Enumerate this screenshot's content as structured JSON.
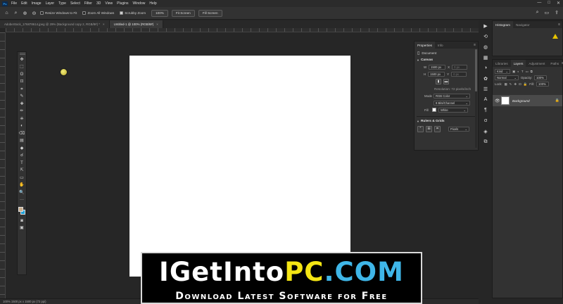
{
  "menubar": {
    "app_logo": "Ps",
    "items": [
      "File",
      "Edit",
      "Image",
      "Layer",
      "Type",
      "Select",
      "Filter",
      "3D",
      "View",
      "Plugins",
      "Window",
      "Help"
    ],
    "window_controls": [
      "—",
      "□",
      "✕"
    ]
  },
  "options": {
    "resize_windows": "Resize Windows to Fit",
    "zoom_all": "Zoom All Windows",
    "scrubby_zoom": "Scrubby Zoom",
    "zoom_value": "100%",
    "fit_screen": "Fit Screen",
    "fill_screen": "Fill Screen"
  },
  "tabs": [
    {
      "label": "AdobeStock_176878614.jpeg @ 29% (Background copy 2, RGB/8#) *",
      "active": false
    },
    {
      "label": "Untitled-1 @ 100% (RGB/8#)",
      "active": true
    }
  ],
  "tab_close": "×",
  "toolbar": {
    "grip_label": "",
    "tools": [
      "✥",
      "⬚",
      "ʘ",
      "⊡",
      "⌗",
      "✎",
      "✚",
      "✏",
      "⎈",
      "◐",
      "⌫",
      "▤",
      "◆",
      "☌",
      "T",
      "⇱",
      "▭",
      "✋",
      "🔍",
      "···"
    ],
    "foreground_color": "#c9ad8c",
    "background_color": "#1fa1d8"
  },
  "properties": {
    "tabs": [
      "Properties",
      "Info"
    ],
    "panel_menu": "≡",
    "doc_label": "Document",
    "canvas_section": "Canvas",
    "width_label": "W",
    "width_value": "1500 px",
    "height_label": "H",
    "height_value": "1500 px",
    "x_label": "X",
    "y_label": "Y",
    "x_value": "0 px",
    "y_value": "0 px",
    "resolution": "Resolution: 72 pixels/inch",
    "mode_label": "Mode",
    "mode_value": "RGB Color",
    "depth_value": "8 Bits/Channel",
    "fill_label": "Fill",
    "fill_value": "White",
    "rulers_section": "Rulers & Grids",
    "units_value": "Pixels"
  },
  "histogram": {
    "tabs": [
      "Histogram",
      "Navigator"
    ],
    "panel_menu": "≡"
  },
  "layers": {
    "tabs": [
      "Libraries",
      "Layers",
      "Adjustment",
      "Paths"
    ],
    "panel_menu": "≡",
    "kind_label": "Kind",
    "mode_value": "Normal",
    "opacity_label": "Opacity:",
    "opacity_value": "100%",
    "lock_label": "Lock:",
    "fill_label": "Fill:",
    "fill_value": "100%",
    "layer_name": "Background",
    "eye_icon": "👁",
    "lock_icon": "🔒"
  },
  "statusbar": {
    "text": "100%     1500 px x 1500 px (72 ppi)"
  },
  "banner": {
    "part1": "IGetInto",
    "part2": "PC",
    "part3": ".COM",
    "subtitle": "Download Latest Software for Free"
  }
}
